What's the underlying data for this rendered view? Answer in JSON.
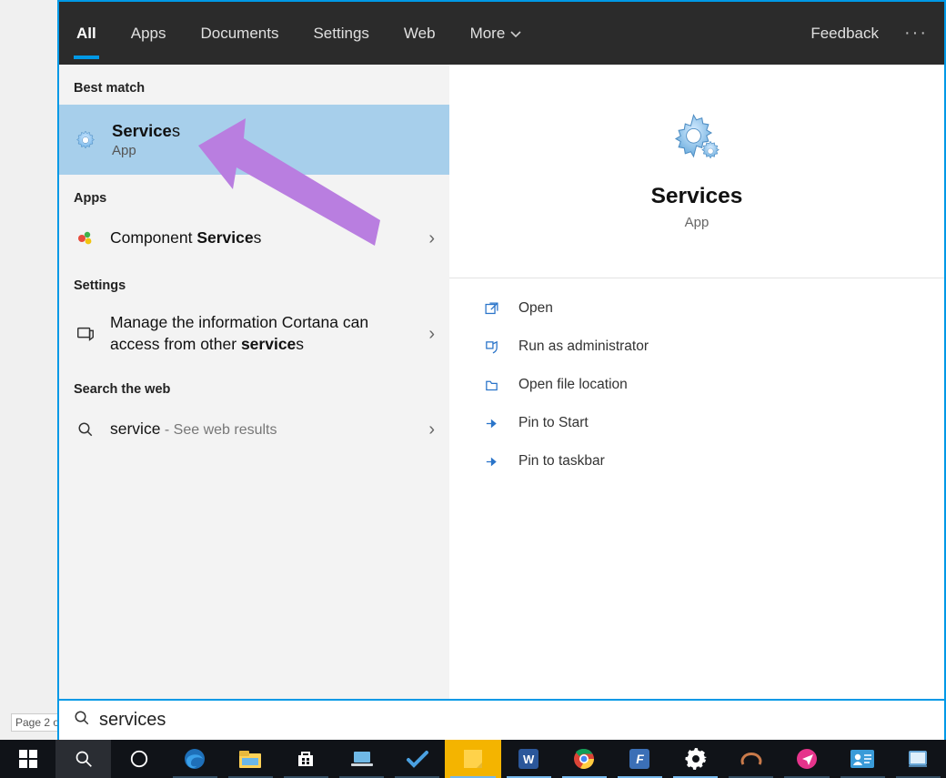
{
  "tabs": {
    "all": "All",
    "apps": "Apps",
    "documents": "Documents",
    "settings": "Settings",
    "web": "Web",
    "more": "More",
    "feedback": "Feedback"
  },
  "sections": {
    "best_match": "Best match",
    "apps": "Apps",
    "settings": "Settings",
    "search_web": "Search the web"
  },
  "best_match": {
    "title_pre": "Service",
    "title_post": "s",
    "subtitle": "App"
  },
  "apps_row": {
    "pre": "Component ",
    "bold": "Service",
    "post": "s"
  },
  "settings_row": {
    "pre": "Manage the information Cortana can access from other ",
    "bold": "service",
    "post": "s"
  },
  "web_row": {
    "term": "service",
    "suffix": " - See web results"
  },
  "details": {
    "title": "Services",
    "subtitle": "App"
  },
  "actions": {
    "open": "Open",
    "run_admin": "Run as administrator",
    "open_loc": "Open file location",
    "pin_start": "Pin to Start",
    "pin_taskbar": "Pin to taskbar"
  },
  "search_value": "services",
  "page_counter": "Page 2 o",
  "colors": {
    "accent": "#0099e6",
    "highlight": "#a7cfeb",
    "arrow": "#b97ee0"
  },
  "taskbar_icons": [
    "start-icon",
    "search-icon",
    "cortana-icon",
    "edge-icon",
    "file-explorer-icon",
    "store-icon",
    "laptop-icon",
    "todo-icon",
    "sticky-notes-icon",
    "word-icon",
    "chrome-icon",
    "foxit-icon",
    "settings-icon",
    "photoscape-icon",
    "send-anywhere-icon",
    "contacts-icon",
    "notepad-icon"
  ]
}
